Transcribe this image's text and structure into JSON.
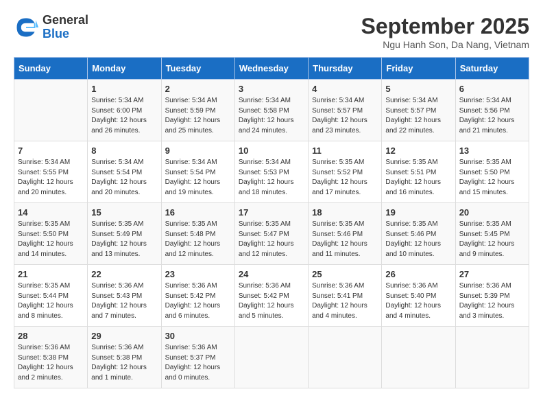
{
  "header": {
    "logo": {
      "general": "General",
      "blue": "Blue"
    },
    "title": "September 2025",
    "location": "Ngu Hanh Son, Da Nang, Vietnam"
  },
  "calendar": {
    "days_of_week": [
      "Sunday",
      "Monday",
      "Tuesday",
      "Wednesday",
      "Thursday",
      "Friday",
      "Saturday"
    ],
    "weeks": [
      [
        {
          "day": "",
          "info": ""
        },
        {
          "day": "1",
          "info": "Sunrise: 5:34 AM\nSunset: 6:00 PM\nDaylight: 12 hours\nand 26 minutes."
        },
        {
          "day": "2",
          "info": "Sunrise: 5:34 AM\nSunset: 5:59 PM\nDaylight: 12 hours\nand 25 minutes."
        },
        {
          "day": "3",
          "info": "Sunrise: 5:34 AM\nSunset: 5:58 PM\nDaylight: 12 hours\nand 24 minutes."
        },
        {
          "day": "4",
          "info": "Sunrise: 5:34 AM\nSunset: 5:57 PM\nDaylight: 12 hours\nand 23 minutes."
        },
        {
          "day": "5",
          "info": "Sunrise: 5:34 AM\nSunset: 5:57 PM\nDaylight: 12 hours\nand 22 minutes."
        },
        {
          "day": "6",
          "info": "Sunrise: 5:34 AM\nSunset: 5:56 PM\nDaylight: 12 hours\nand 21 minutes."
        }
      ],
      [
        {
          "day": "7",
          "info": "Sunrise: 5:34 AM\nSunset: 5:55 PM\nDaylight: 12 hours\nand 20 minutes."
        },
        {
          "day": "8",
          "info": "Sunrise: 5:34 AM\nSunset: 5:54 PM\nDaylight: 12 hours\nand 20 minutes."
        },
        {
          "day": "9",
          "info": "Sunrise: 5:34 AM\nSunset: 5:54 PM\nDaylight: 12 hours\nand 19 minutes."
        },
        {
          "day": "10",
          "info": "Sunrise: 5:34 AM\nSunset: 5:53 PM\nDaylight: 12 hours\nand 18 minutes."
        },
        {
          "day": "11",
          "info": "Sunrise: 5:35 AM\nSunset: 5:52 PM\nDaylight: 12 hours\nand 17 minutes."
        },
        {
          "day": "12",
          "info": "Sunrise: 5:35 AM\nSunset: 5:51 PM\nDaylight: 12 hours\nand 16 minutes."
        },
        {
          "day": "13",
          "info": "Sunrise: 5:35 AM\nSunset: 5:50 PM\nDaylight: 12 hours\nand 15 minutes."
        }
      ],
      [
        {
          "day": "14",
          "info": "Sunrise: 5:35 AM\nSunset: 5:50 PM\nDaylight: 12 hours\nand 14 minutes."
        },
        {
          "day": "15",
          "info": "Sunrise: 5:35 AM\nSunset: 5:49 PM\nDaylight: 12 hours\nand 13 minutes."
        },
        {
          "day": "16",
          "info": "Sunrise: 5:35 AM\nSunset: 5:48 PM\nDaylight: 12 hours\nand 12 minutes."
        },
        {
          "day": "17",
          "info": "Sunrise: 5:35 AM\nSunset: 5:47 PM\nDaylight: 12 hours\nand 12 minutes."
        },
        {
          "day": "18",
          "info": "Sunrise: 5:35 AM\nSunset: 5:46 PM\nDaylight: 12 hours\nand 11 minutes."
        },
        {
          "day": "19",
          "info": "Sunrise: 5:35 AM\nSunset: 5:46 PM\nDaylight: 12 hours\nand 10 minutes."
        },
        {
          "day": "20",
          "info": "Sunrise: 5:35 AM\nSunset: 5:45 PM\nDaylight: 12 hours\nand 9 minutes."
        }
      ],
      [
        {
          "day": "21",
          "info": "Sunrise: 5:35 AM\nSunset: 5:44 PM\nDaylight: 12 hours\nand 8 minutes."
        },
        {
          "day": "22",
          "info": "Sunrise: 5:36 AM\nSunset: 5:43 PM\nDaylight: 12 hours\nand 7 minutes."
        },
        {
          "day": "23",
          "info": "Sunrise: 5:36 AM\nSunset: 5:42 PM\nDaylight: 12 hours\nand 6 minutes."
        },
        {
          "day": "24",
          "info": "Sunrise: 5:36 AM\nSunset: 5:42 PM\nDaylight: 12 hours\nand 5 minutes."
        },
        {
          "day": "25",
          "info": "Sunrise: 5:36 AM\nSunset: 5:41 PM\nDaylight: 12 hours\nand 4 minutes."
        },
        {
          "day": "26",
          "info": "Sunrise: 5:36 AM\nSunset: 5:40 PM\nDaylight: 12 hours\nand 4 minutes."
        },
        {
          "day": "27",
          "info": "Sunrise: 5:36 AM\nSunset: 5:39 PM\nDaylight: 12 hours\nand 3 minutes."
        }
      ],
      [
        {
          "day": "28",
          "info": "Sunrise: 5:36 AM\nSunset: 5:38 PM\nDaylight: 12 hours\nand 2 minutes."
        },
        {
          "day": "29",
          "info": "Sunrise: 5:36 AM\nSunset: 5:38 PM\nDaylight: 12 hours\nand 1 minute."
        },
        {
          "day": "30",
          "info": "Sunrise: 5:36 AM\nSunset: 5:37 PM\nDaylight: 12 hours\nand 0 minutes."
        },
        {
          "day": "",
          "info": ""
        },
        {
          "day": "",
          "info": ""
        },
        {
          "day": "",
          "info": ""
        },
        {
          "day": "",
          "info": ""
        }
      ]
    ]
  }
}
